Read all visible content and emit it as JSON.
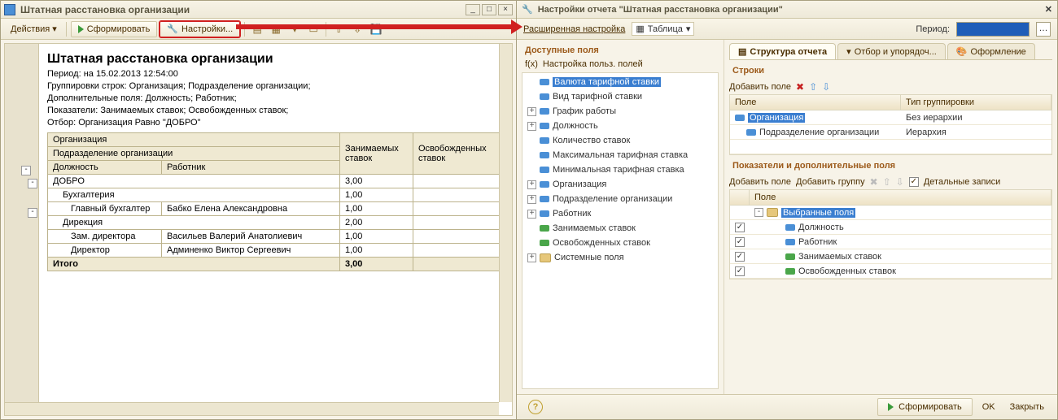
{
  "window_title": "Штатная расстановка организации",
  "toolbar": {
    "actions": "Действия ▾",
    "generate": "Сформировать",
    "settings": "Настройки..."
  },
  "report": {
    "title": "Штатная расстановка организации",
    "period": "Период: на 15.02.2013 12:54:00",
    "groups": "Группировки строк: Организация; Подразделение организации;",
    "extrafields": "Дополнительные поля: Должность; Работник;",
    "indicators": "Показатели: Занимаемых ставок; Освобожденных ставок;",
    "filter": "Отбор: Организация Равно \"ДОБРО\""
  },
  "headers": {
    "org": "Организация",
    "dept": "Подразделение организации",
    "job": "Должность",
    "worker": "Работник",
    "taken": "Занимаемых ставок",
    "free": "Освобожденных ставок",
    "total": "Итого"
  },
  "rows": {
    "r0_org": "ДОБРО",
    "r0_taken": "3,00",
    "r1_dept": "Бухгалтерия",
    "r1_taken": "1,00",
    "r2_job": "Главный бухгалтер",
    "r2_worker": "Бабко Елена Александровна",
    "r2_taken": "1,00",
    "r3_dept": "Дирекция",
    "r3_taken": "2,00",
    "r4_job": "Зам. директора",
    "r4_worker": "Васильев Валерий Анатолиевич",
    "r4_taken": "1,00",
    "r5_job": "Директор",
    "r5_worker": "Админенко Виктор Сергеевич",
    "r5_taken": "1,00",
    "total_taken": "3,00"
  },
  "settings_title": "Настройки отчета \"Штатная расстановка организации\"",
  "panel_toolbar": {
    "advanced": "Расширенная настройка",
    "table": "Таблица",
    "period_label": "Период:"
  },
  "avail": {
    "header": "Доступные поля",
    "customfields": "Настройка польз. полей",
    "items": {
      "i0": "Валюта тарифной ставки",
      "i1": "Вид тарифной ставки",
      "i2": "График работы",
      "i3": "Должность",
      "i4": "Количество ставок",
      "i5": "Максимальная тарифная ставка",
      "i6": "Минимальная тарифная ставка",
      "i7": "Организация",
      "i8": "Подразделение организации",
      "i9": "Работник",
      "i10": "Занимаемых ставок",
      "i11": "Освобожденных ставок",
      "i12": "Системные поля"
    }
  },
  "tabs": {
    "t0": "Структура отчета",
    "t1": "Отбор и упорядоч...",
    "t2": "Оформление"
  },
  "rows_section": {
    "header": "Строки",
    "add": "Добавить поле",
    "col_field": "Поле",
    "col_type": "Тип группировки",
    "g0_field": "Организация",
    "g0_type": "Без иерархии",
    "g1_field": "Подразделение организации",
    "g1_type": "Иерархия"
  },
  "fields_section": {
    "header": "Показатели и дополнительные поля",
    "add_field": "Добавить поле",
    "add_group": "Добавить группу",
    "detailed": "Детальные записи",
    "col_field": "Поле",
    "root": "Выбранные поля",
    "f0": "Должность",
    "f1": "Работник",
    "f2": "Занимаемых ставок",
    "f3": "Освобожденных ставок"
  },
  "footer": {
    "generate": "Сформировать",
    "ok": "OK",
    "close": "Закрыть"
  }
}
